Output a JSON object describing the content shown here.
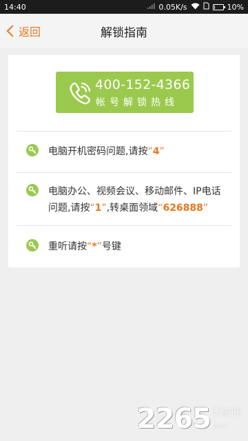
{
  "status_bar": {
    "time": "14:40",
    "network_speed": "0.05K/s",
    "battery_percent": "10%",
    "battery_level": 0.1
  },
  "header": {
    "back_label": "返回",
    "title": "解锁指南"
  },
  "hotline": {
    "phone_number": "400-152-4366",
    "label": "帐号解锁热线"
  },
  "instructions": [
    {
      "text_before": "电脑开机密码问题,请按",
      "key": "4"
    },
    {
      "line1": "电脑办公、视频会议、移动邮件、IP电话",
      "text_before": "问题,请按",
      "key": "1",
      "text_middle": ",转桌面领域",
      "extension": "626888"
    },
    {
      "text_before": "重听请按",
      "key": "*",
      "text_after": "号键"
    }
  ],
  "quote_open": "“",
  "quote_close": "”",
  "watermark": {
    "digits": "2265",
    "text": "手游网",
    "suffix": ".com"
  },
  "colors": {
    "accent_orange": "#e8771e",
    "button_green": "#9bc94e",
    "background": "#efefef"
  }
}
